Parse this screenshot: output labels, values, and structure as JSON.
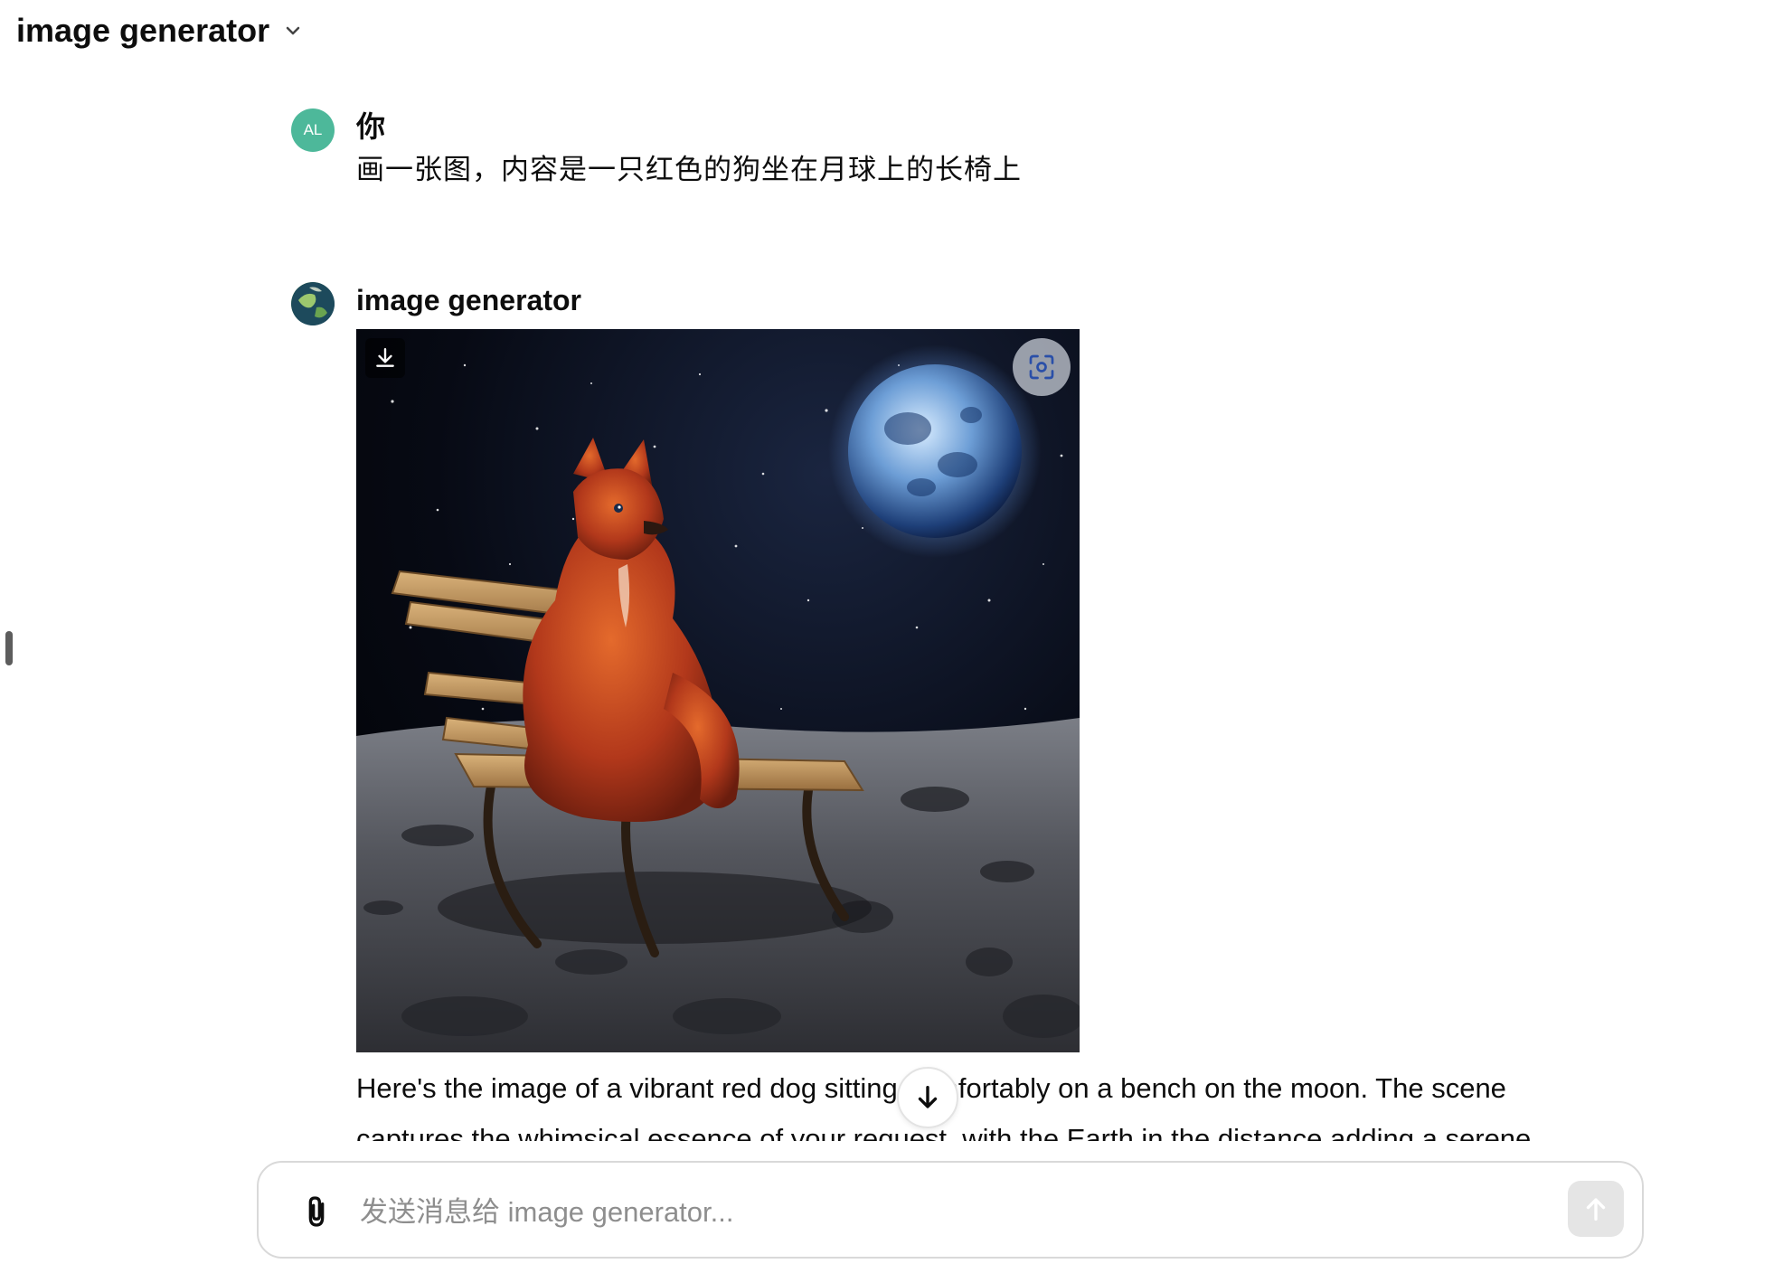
{
  "header": {
    "title": "image generator"
  },
  "conversation": {
    "user": {
      "avatar_initials": "AL",
      "author": "你",
      "message": "画一张图，内容是一只红色的狗坐在月球上的长椅上"
    },
    "assistant": {
      "author": "image generator",
      "response_text": "Here's the image of a vibrant red dog sitting comfortably on a bench on the moon. The scene captures the whimsical essence of your request, with the Earth in the distance adding a serene"
    }
  },
  "composer": {
    "placeholder": "发送消息给 image generator..."
  },
  "icons": {
    "header_chevron": "chevron-down-icon",
    "image_download": "download-icon",
    "image_expand": "focus-icon",
    "scroll_down": "arrow-down-icon",
    "attach": "paperclip-icon",
    "send": "arrow-up-icon"
  },
  "colors": {
    "user_avatar": "#4db89a",
    "send_disabled": "#e5e5e5"
  }
}
